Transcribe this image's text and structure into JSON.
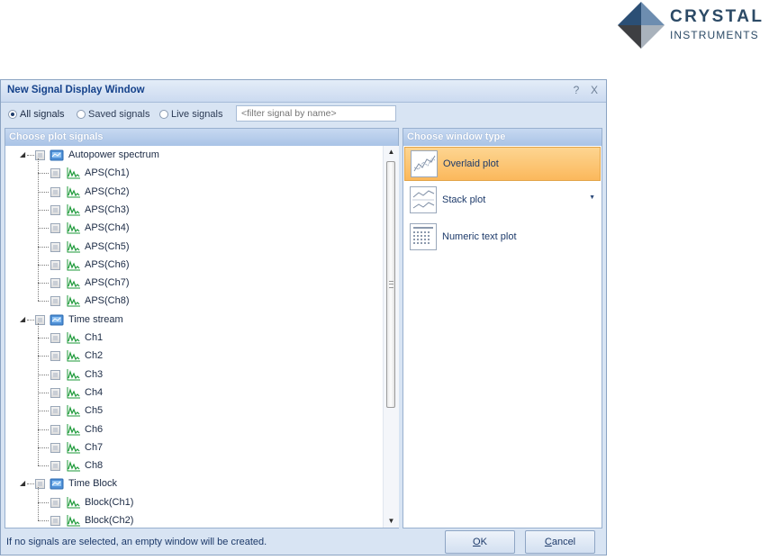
{
  "logo": {
    "line1": "CRYSTAL",
    "line2": "INSTRUMENTS"
  },
  "dialog": {
    "title": "New Signal Display Window",
    "help_glyph": "?",
    "close_glyph": "X"
  },
  "filter": {
    "options": [
      {
        "label": "All signals",
        "selected": true
      },
      {
        "label": "Saved signals",
        "selected": false
      },
      {
        "label": "Live signals",
        "selected": false
      }
    ],
    "placeholder": "<filter signal by name>"
  },
  "signals_panel": {
    "header": "Choose plot signals",
    "groups": [
      {
        "label": "Autopower spectrum",
        "icon": "folder-signal-icon",
        "items": [
          "APS(Ch1)",
          "APS(Ch2)",
          "APS(Ch3)",
          "APS(Ch4)",
          "APS(Ch5)",
          "APS(Ch6)",
          "APS(Ch7)",
          "APS(Ch8)"
        ]
      },
      {
        "label": "Time stream",
        "icon": "folder-signal-icon",
        "items": [
          "Ch1",
          "Ch2",
          "Ch3",
          "Ch4",
          "Ch5",
          "Ch6",
          "Ch7",
          "Ch8"
        ]
      },
      {
        "label": "Time Block",
        "icon": "folder-signal-icon",
        "items": [
          "Block(Ch1)",
          "Block(Ch2)"
        ]
      }
    ]
  },
  "window_type_panel": {
    "header": "Choose window type",
    "items": [
      {
        "label": "Overlaid plot",
        "icon": "overlaid-plot-icon",
        "selected": true
      },
      {
        "label": "Stack plot",
        "icon": "stack-plot-icon",
        "selected": false
      },
      {
        "label": "Numeric text plot",
        "icon": "numeric-text-plot-icon",
        "selected": false
      }
    ]
  },
  "footer": {
    "note": "If no signals are selected, an empty window will be created.",
    "ok_label": "OK",
    "cancel_label": "Cancel"
  }
}
